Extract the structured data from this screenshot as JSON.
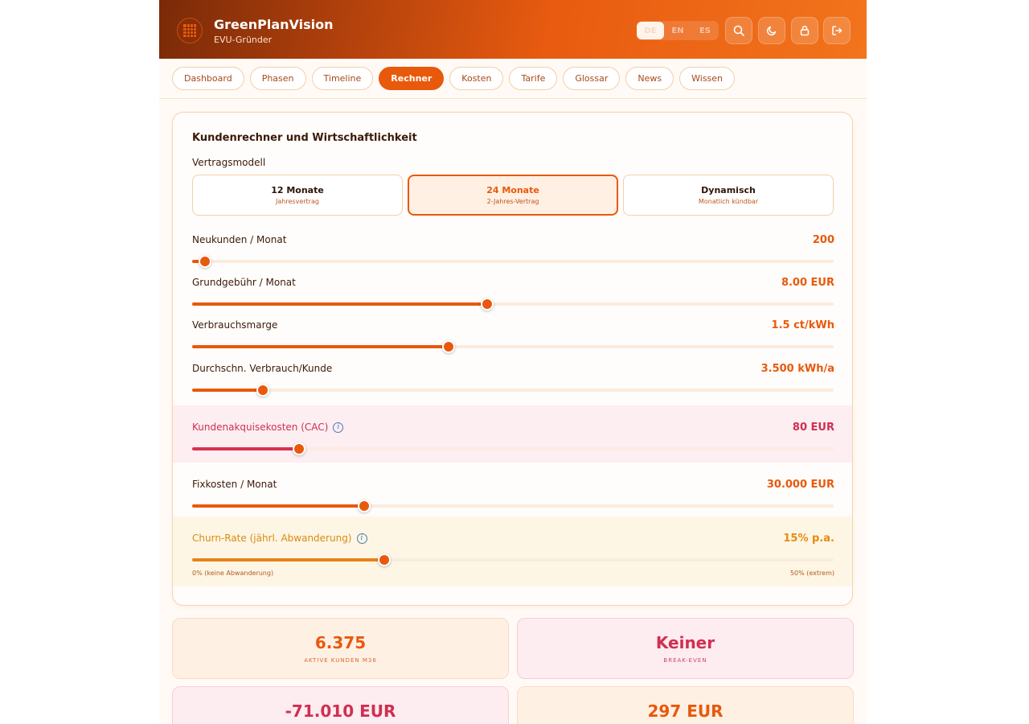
{
  "app": {
    "title": "GreenPlanVision",
    "subtitle": "EVU-Gründer"
  },
  "languages": [
    {
      "label": "DE",
      "active": true
    },
    {
      "label": "EN",
      "active": false
    },
    {
      "label": "ES",
      "active": false
    }
  ],
  "header_icons": [
    "search-icon",
    "moon-icon",
    "lock-icon",
    "logout-icon"
  ],
  "nav": [
    {
      "label": "Dashboard",
      "active": false
    },
    {
      "label": "Phasen",
      "active": false
    },
    {
      "label": "Timeline",
      "active": false
    },
    {
      "label": "Rechner",
      "active": true
    },
    {
      "label": "Kosten",
      "active": false
    },
    {
      "label": "Tarife",
      "active": false
    },
    {
      "label": "Glossar",
      "active": false
    },
    {
      "label": "News",
      "active": false
    },
    {
      "label": "Wissen",
      "active": false
    }
  ],
  "calculator": {
    "title": "Kundenrechner und Wirtschaftlichkeit",
    "contract_label": "Vertragsmodell",
    "contract_models": [
      {
        "name": "12 Monate",
        "desc": "Jahresvertrag",
        "selected": false
      },
      {
        "name": "24 Monate",
        "desc": "2-Jahres-Vertrag",
        "selected": true
      },
      {
        "name": "Dynamisch",
        "desc": "Monatlich kündbar",
        "selected": false
      }
    ],
    "sliders": [
      {
        "label": "Neukunden / Monat",
        "value": "200",
        "fill_fraction": 0.02,
        "tone": "orange"
      },
      {
        "label": "Grundgebühr / Monat",
        "value": "8.00 EUR",
        "fill_fraction": 0.46,
        "tone": "orange"
      },
      {
        "label": "Verbrauchsmarge",
        "value": "1.5 ct/kWh",
        "fill_fraction": 0.4,
        "tone": "orange"
      },
      {
        "label": "Durchschn. Verbrauch/Kunde",
        "value": "3.500 kWh/a",
        "fill_fraction": 0.11,
        "tone": "orange"
      },
      {
        "label": "Kundenakquisekosten (CAC)",
        "value": "80 EUR",
        "fill_fraction": 0.167,
        "tone": "red"
      },
      {
        "label": "Fixkosten / Monat",
        "value": "30.000 EUR",
        "fill_fraction": 0.268,
        "tone": "orange"
      },
      {
        "label": "Churn-Rate (jährl. Abwanderung)",
        "value": "15% p.a.",
        "fill_fraction": 0.3,
        "tone": "amber"
      }
    ],
    "churn_min_label": "0% (keine Abwanderung)",
    "churn_max_label": "50% (extrem)"
  },
  "metrics": [
    {
      "value": "6.375",
      "caption": "AKTIVE KUNDEN M36",
      "tone": "orange"
    },
    {
      "value": "Keiner",
      "caption": "BREAK-EVEN",
      "tone": "pink"
    },
    {
      "value": "-71.010 EUR",
      "caption": "",
      "tone": "pink"
    },
    {
      "value": "297 EUR",
      "caption": "",
      "tone": "orange"
    }
  ]
}
